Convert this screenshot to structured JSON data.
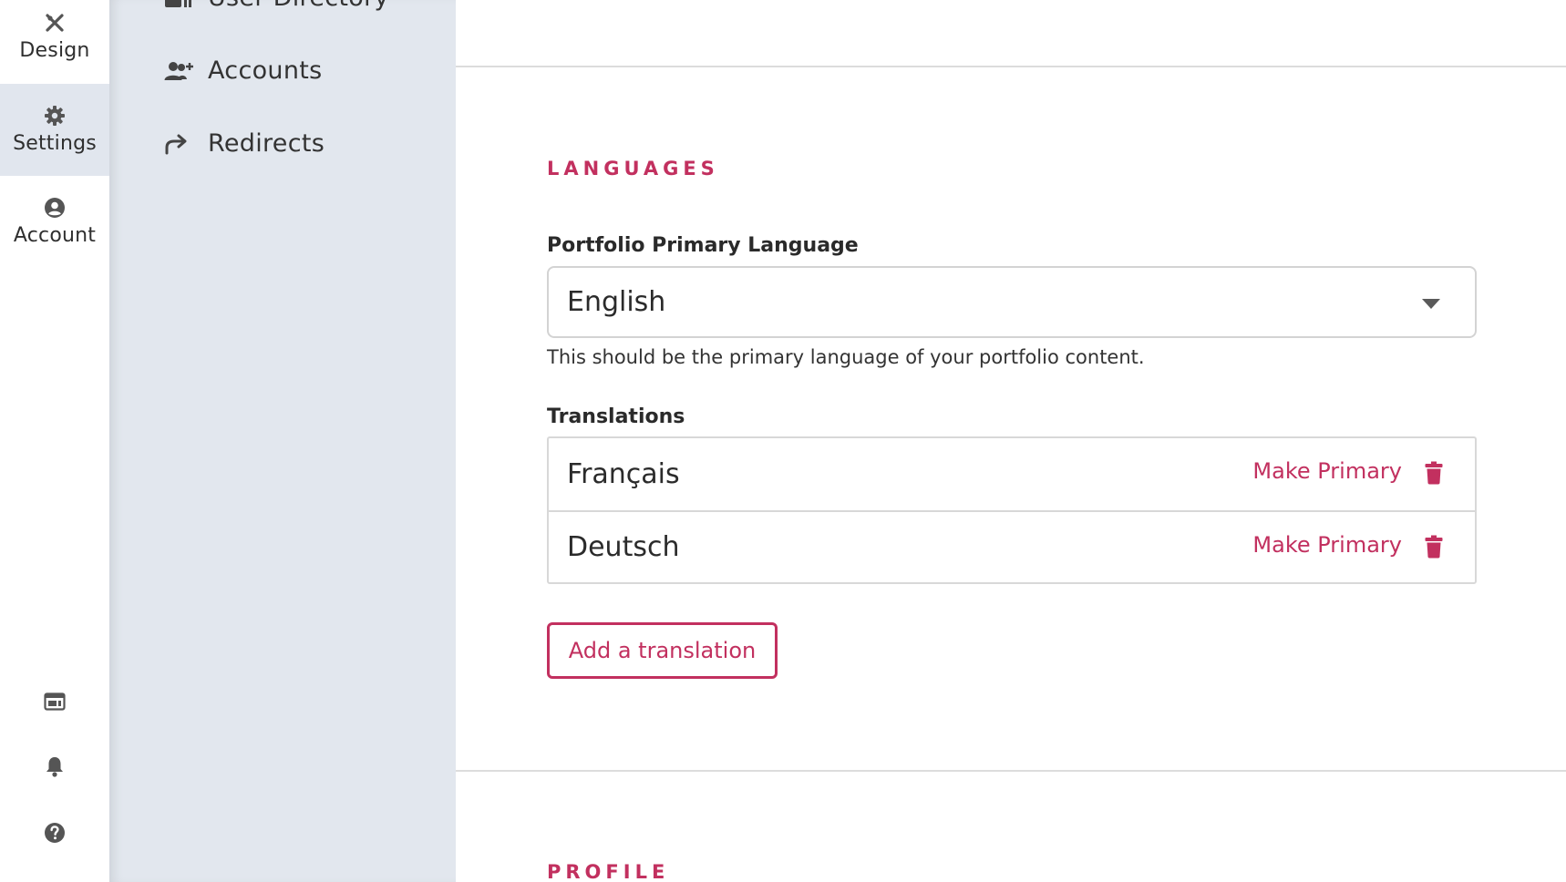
{
  "rail": {
    "items": [
      {
        "label": "Design",
        "icon": "design-icon"
      },
      {
        "label": "Settings",
        "icon": "gear-icon",
        "active": true
      },
      {
        "label": "Account",
        "icon": "account-circle-icon"
      }
    ],
    "bottom_icons": [
      "browser-window-icon",
      "bell-icon",
      "help-icon"
    ]
  },
  "subnav": {
    "items": [
      {
        "label": "User Directory",
        "icon": "user-directory-icon"
      },
      {
        "label": "Accounts",
        "icon": "add-users-icon"
      },
      {
        "label": "Redirects",
        "icon": "redirect-arrow-icon"
      }
    ]
  },
  "languages": {
    "section_title": "LANGUAGES",
    "primary_label": "Portfolio Primary Language",
    "primary_value": "English",
    "helper": "This should be the primary language of your portfolio content.",
    "translations_label": "Translations",
    "translations": [
      {
        "name": "Français",
        "action": "Make Primary"
      },
      {
        "name": "Deutsch",
        "action": "Make Primary"
      }
    ],
    "add_button": "Add a translation"
  },
  "profile": {
    "section_title": "PROFILE"
  },
  "colors": {
    "accent": "#c2305f",
    "sidebar_bg": "#e2e7ee",
    "active_rail_bg": "#e1e6ee"
  }
}
